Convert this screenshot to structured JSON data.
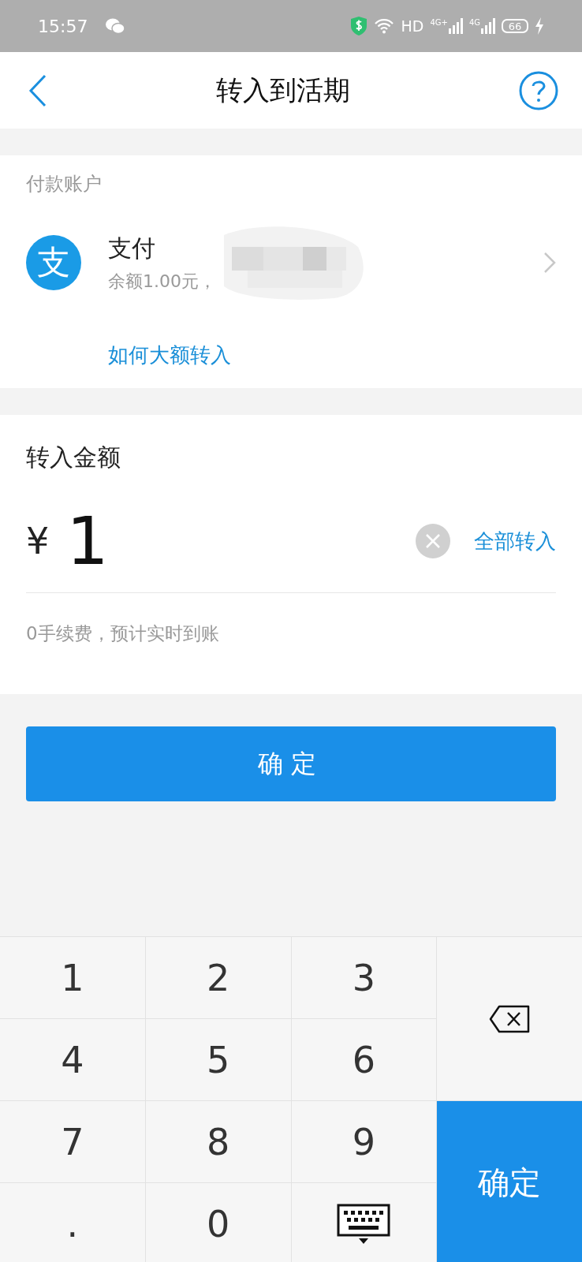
{
  "status_bar": {
    "time": "15:57",
    "hd": "HD",
    "network_labels": [
      "4G+",
      "4G"
    ],
    "battery": "66",
    "charging": true
  },
  "nav": {
    "title": "转入到活期"
  },
  "account": {
    "heading": "付款账户",
    "logo_char": "支",
    "name": "支付",
    "balance": "余额1.00元，",
    "link": "如何大额转入"
  },
  "amount": {
    "heading": "转入金额",
    "currency": "¥",
    "value": "1",
    "all_button": "全部转入",
    "note": "0手续费，预计实时到账"
  },
  "confirm_button": "确定",
  "keypad": {
    "keys": [
      {
        "kind": "digit",
        "label": "1"
      },
      {
        "kind": "digit",
        "label": "2"
      },
      {
        "kind": "digit",
        "label": "3"
      },
      {
        "kind": "delete"
      },
      {
        "kind": "digit",
        "label": "4"
      },
      {
        "kind": "digit",
        "label": "5"
      },
      {
        "kind": "digit",
        "label": "6"
      },
      {
        "kind": "digit",
        "label": "7"
      },
      {
        "kind": "digit",
        "label": "8"
      },
      {
        "kind": "digit",
        "label": "9"
      },
      {
        "kind": "confirm",
        "label": "确定"
      },
      {
        "kind": "digit",
        "label": "."
      },
      {
        "kind": "digit",
        "label": "0"
      },
      {
        "kind": "hide"
      }
    ]
  }
}
